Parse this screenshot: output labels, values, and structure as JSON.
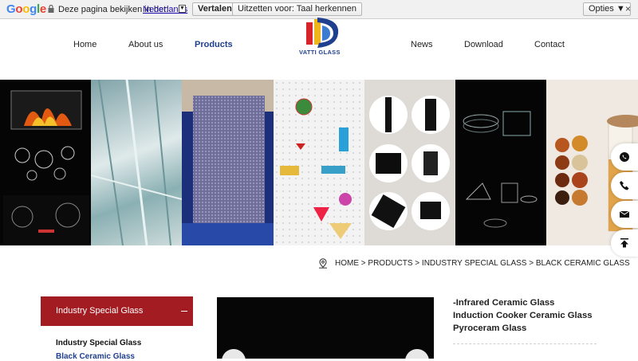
{
  "translate_bar": {
    "logo": "Google",
    "message": "Deze pagina bekijken in het:",
    "language": "Nederlands",
    "translate_label": "Vertalen",
    "original_label": "Uitzetten voor: Taal herkennen",
    "options_label": "Opties ▼",
    "close_label": "×"
  },
  "nav": {
    "items": [
      "Home",
      "About us",
      "Products",
      "News",
      "Download",
      "Contact"
    ],
    "active": "Products",
    "logo_text": "VATTI GLASS",
    "brand_colors": {
      "red": "#d8232a",
      "blue": "#1f3f8f"
    }
  },
  "breadcrumb": [
    "HOME >",
    "PRODUCTS >",
    "INDUSTRY SPECIAL GLASS >",
    "BLACK CERAMIC GLASS"
  ],
  "sidebar": {
    "header": "Industry Special Glass",
    "header_toggle": "−",
    "header_color": "#a31c22",
    "links": [
      "Industry Special Glass",
      "Black Ceramic Glass"
    ]
  },
  "product": {
    "title": "-Infrared Ceramic Glass Induction Cooker Ceramic Glass Pyroceram Glass"
  },
  "side_icons": [
    "whatsapp-icon",
    "phone-icon",
    "mail-icon",
    "back-to-top-icon"
  ]
}
